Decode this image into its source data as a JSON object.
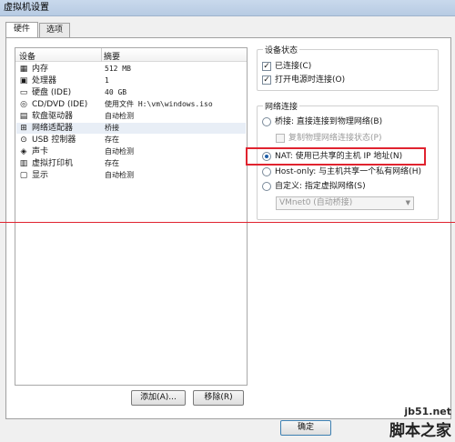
{
  "window": {
    "title": "虚拟机设置"
  },
  "tabs": [
    {
      "label": "硬件",
      "active": true
    },
    {
      "label": "选项",
      "active": false
    }
  ],
  "device_list": {
    "col_device": "设备",
    "col_summary": "摘要",
    "rows": [
      {
        "icon": "memory-icon",
        "name": "内存",
        "summary": "512 MB"
      },
      {
        "icon": "processor-icon",
        "name": "处理器",
        "summary": "1"
      },
      {
        "icon": "hard-disk-icon",
        "name": "硬盘 (IDE)",
        "summary": "40 GB"
      },
      {
        "icon": "cd-dvd-icon",
        "name": "CD/DVD (IDE)",
        "summary": "使用文件 H:\\vm\\windows.iso"
      },
      {
        "icon": "floppy-icon",
        "name": "软盘驱动器",
        "summary": "自动检测"
      },
      {
        "icon": "network-adapter-icon",
        "name": "网络适配器",
        "summary": "桥接",
        "selected": true
      },
      {
        "icon": "usb-icon",
        "name": "USB 控制器",
        "summary": "存在"
      },
      {
        "icon": "sound-card-icon",
        "name": "声卡",
        "summary": "自动检测"
      },
      {
        "icon": "printer-icon",
        "name": "虚拟打印机",
        "summary": "存在"
      },
      {
        "icon": "display-icon",
        "name": "显示",
        "summary": "自动检测"
      }
    ]
  },
  "buttons": {
    "add": "添加(A)...",
    "remove": "移除(R)",
    "ok": "确定"
  },
  "device_status": {
    "title": "设备状态",
    "connected": {
      "label": "已连接(C)",
      "checked": true
    },
    "connect_at_power_on": {
      "label": "打开电源时连接(O)",
      "checked": true
    }
  },
  "network_connection": {
    "title": "网络连接",
    "bridged": {
      "label": "桥接: 直接连接到物理网络(B)",
      "selected": false
    },
    "replicate": {
      "label": "复制物理网络连接状态(P)",
      "checked": false,
      "enabled": false
    },
    "nat": {
      "label": "NAT: 使用已共享的主机 IP 地址(N)",
      "selected": true
    },
    "host_only": {
      "label": "Host-only: 与主机共享一个私有网络(H)",
      "selected": false
    },
    "custom": {
      "label": "自定义: 指定虚拟网络(S)",
      "selected": false
    },
    "vmnet_select": {
      "value": "VMnet0 (自动桥接)",
      "enabled": false
    }
  },
  "watermark": {
    "url": "jb51.net",
    "brand": "脚本之家"
  },
  "colors": {
    "highlight_red": "#e0232f",
    "selected_row": "#e8eef6"
  }
}
